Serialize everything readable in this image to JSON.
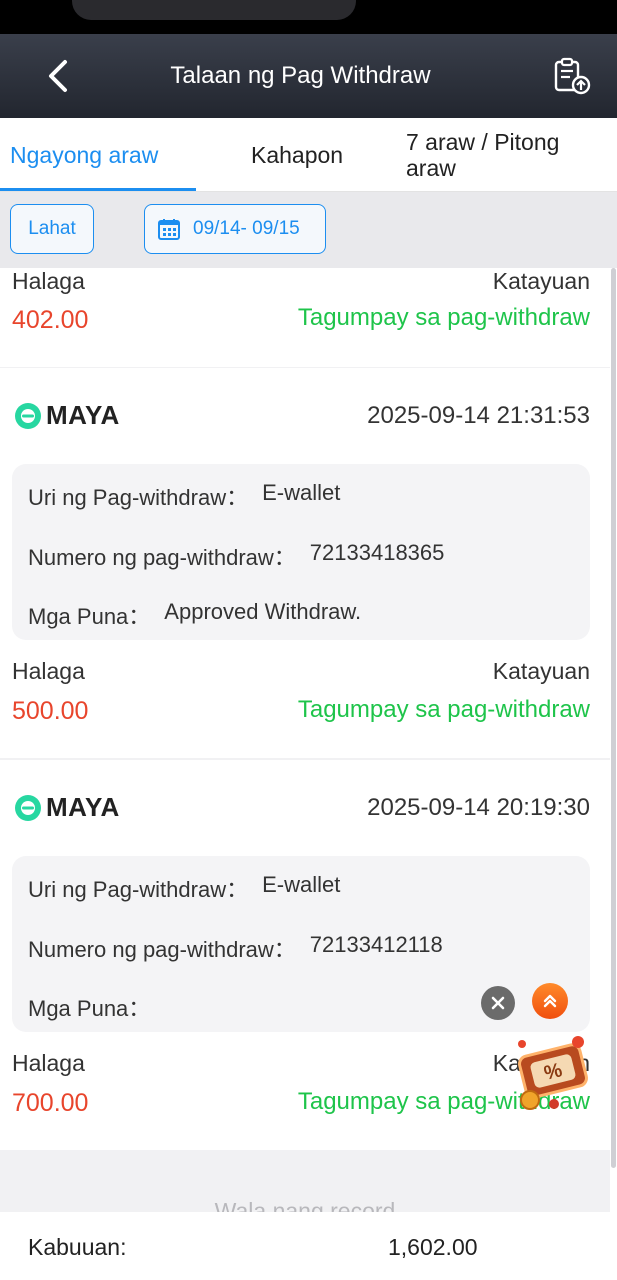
{
  "header": {
    "title": "Talaan ng Pag Withdraw"
  },
  "tabs": [
    {
      "label": "Ngayong araw",
      "active": true
    },
    {
      "label": "Kahapon",
      "active": false
    },
    {
      "label": "7 araw / Pitong araw",
      "active": false
    }
  ],
  "filters": {
    "all_label": "Lahat",
    "date_range": "09/14- 09/15"
  },
  "records": [
    {
      "amount_label": "Halaga",
      "amount": "402.00",
      "status_label": "Katayuan",
      "status": "Tagumpay sa pag-withdraw"
    },
    {
      "brand": "MAYA",
      "time": "2025-09-14 21:31:53",
      "type_label": "Uri ng Pag-withdraw：",
      "type": "E-wallet",
      "number_label": "Numero ng pag-withdraw：",
      "number": "72133418365",
      "remarks_label": "Mga Puna：",
      "remarks": "Approved Withdraw.",
      "amount_label": "Halaga",
      "amount": "500.00",
      "status_label": "Katayuan",
      "status": "Tagumpay sa pag-withdraw"
    },
    {
      "brand": "MAYA",
      "time": "2025-09-14 20:19:30",
      "type_label": "Uri ng Pag-withdraw：",
      "type": "E-wallet",
      "number_label": "Numero ng pag-withdraw：",
      "number": "72133412118",
      "remarks_label": "Mga Puna：",
      "remarks": "",
      "amount_label": "Halaga",
      "amount": "700.00",
      "status_label": "Katayuan",
      "status": "Tagumpay sa pag-withdraw"
    }
  ],
  "list_end_text": "Wala nang record",
  "footer": {
    "total_label": "Kabuuan:",
    "total_value": "1,602.00"
  },
  "colors": {
    "accent": "#1c8ef0",
    "amount": "#e8452c",
    "success": "#1ec44a",
    "header_bg": "#2b2f39",
    "maya": "#27d7a1"
  },
  "icons": [
    "back-arrow-icon",
    "record-upload-icon",
    "calendar-icon",
    "maya-logo-icon",
    "close-icon",
    "double-chevron-up-icon",
    "promo-gift-icon"
  ]
}
